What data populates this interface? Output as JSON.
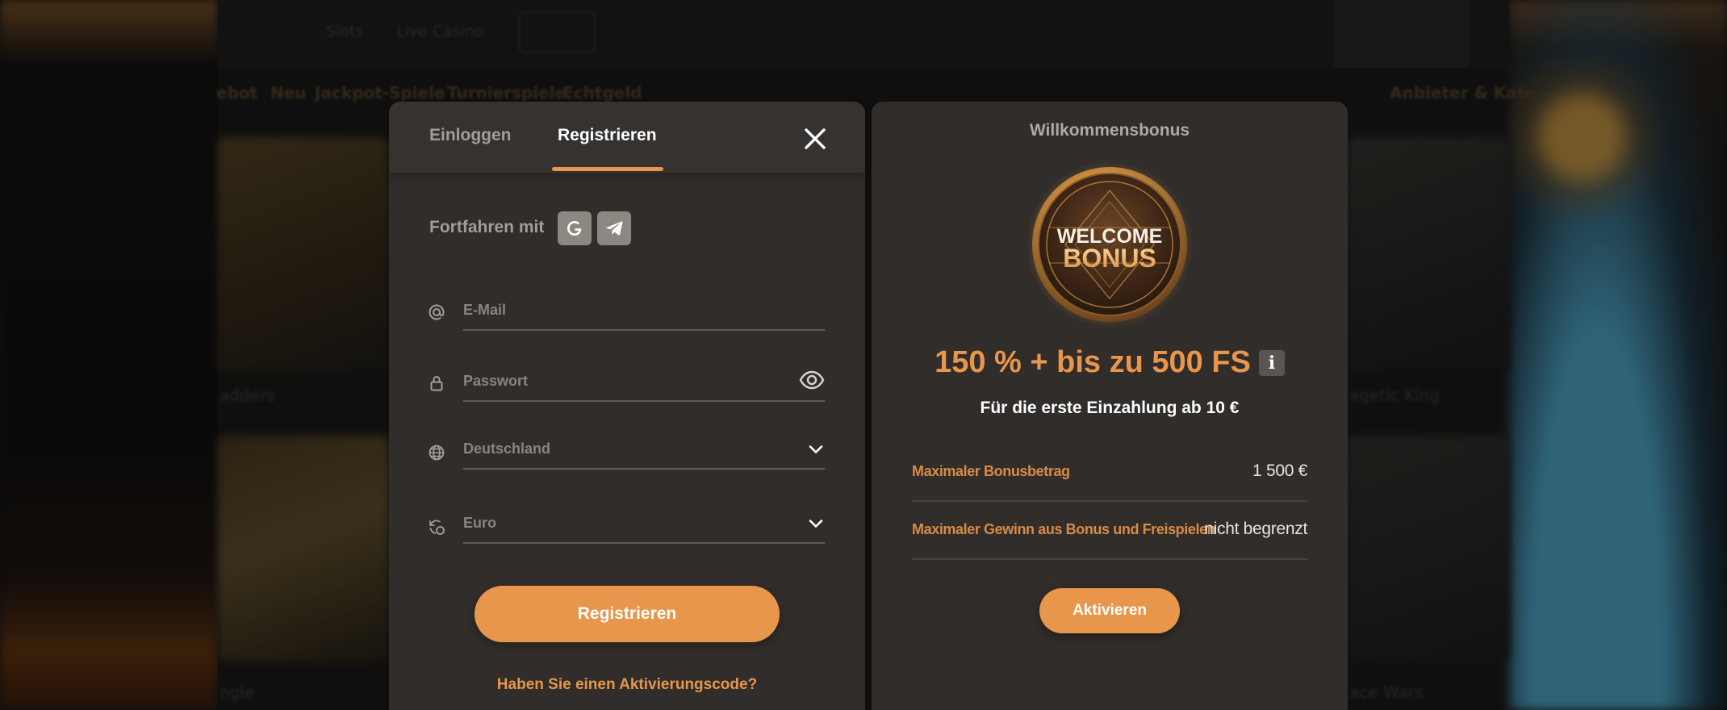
{
  "background": {
    "nav_links": [
      "Slots",
      "Live Casino"
    ],
    "categories": [
      "ebot",
      "Neu",
      "Jackpot-Spiele",
      "Turnierspiele",
      "Echtgeld"
    ],
    "right_category": "Anbieter & Kate",
    "tile_labels": [
      "adders",
      "ngle",
      "agetic King",
      "ace Wars"
    ]
  },
  "auth": {
    "tabs": [
      {
        "label": "Einloggen",
        "active": false
      },
      {
        "label": "Registrieren",
        "active": true
      }
    ],
    "continue_with_label": "Fortfahren mit",
    "social": [
      "google-icon",
      "telegram-icon"
    ],
    "fields": {
      "email": {
        "placeholder": "E-Mail",
        "icon": "at-icon"
      },
      "password": {
        "placeholder": "Passwort",
        "icon": "lock-icon"
      },
      "country": {
        "value": "Deutschland",
        "icon": "globe-icon"
      },
      "currency": {
        "value": "Euro",
        "icon": "currency-exchange-icon"
      }
    },
    "submit_label": "Registrieren",
    "activation_link": "Haben Sie einen Aktivierungscode?"
  },
  "bonus": {
    "title": "Willkommensbonus",
    "coin_line1": "WELCOME",
    "coin_line2": "BONUS",
    "offer": "150 % + bis zu 500 FS",
    "info_label": "i",
    "subtitle": "Für die erste Einzahlung ab 10 €",
    "rows": [
      {
        "label": "Maximaler Bonusbetrag",
        "value": "1 500 €"
      },
      {
        "label": "Maximaler Gewinn aus Bonus und Freispielen",
        "value": "nicht begrenzt"
      }
    ],
    "activate_label": "Aktivieren"
  },
  "colors": {
    "accent": "#e8964b",
    "panel": "#312d2a",
    "muted_text": "#a39d96"
  }
}
